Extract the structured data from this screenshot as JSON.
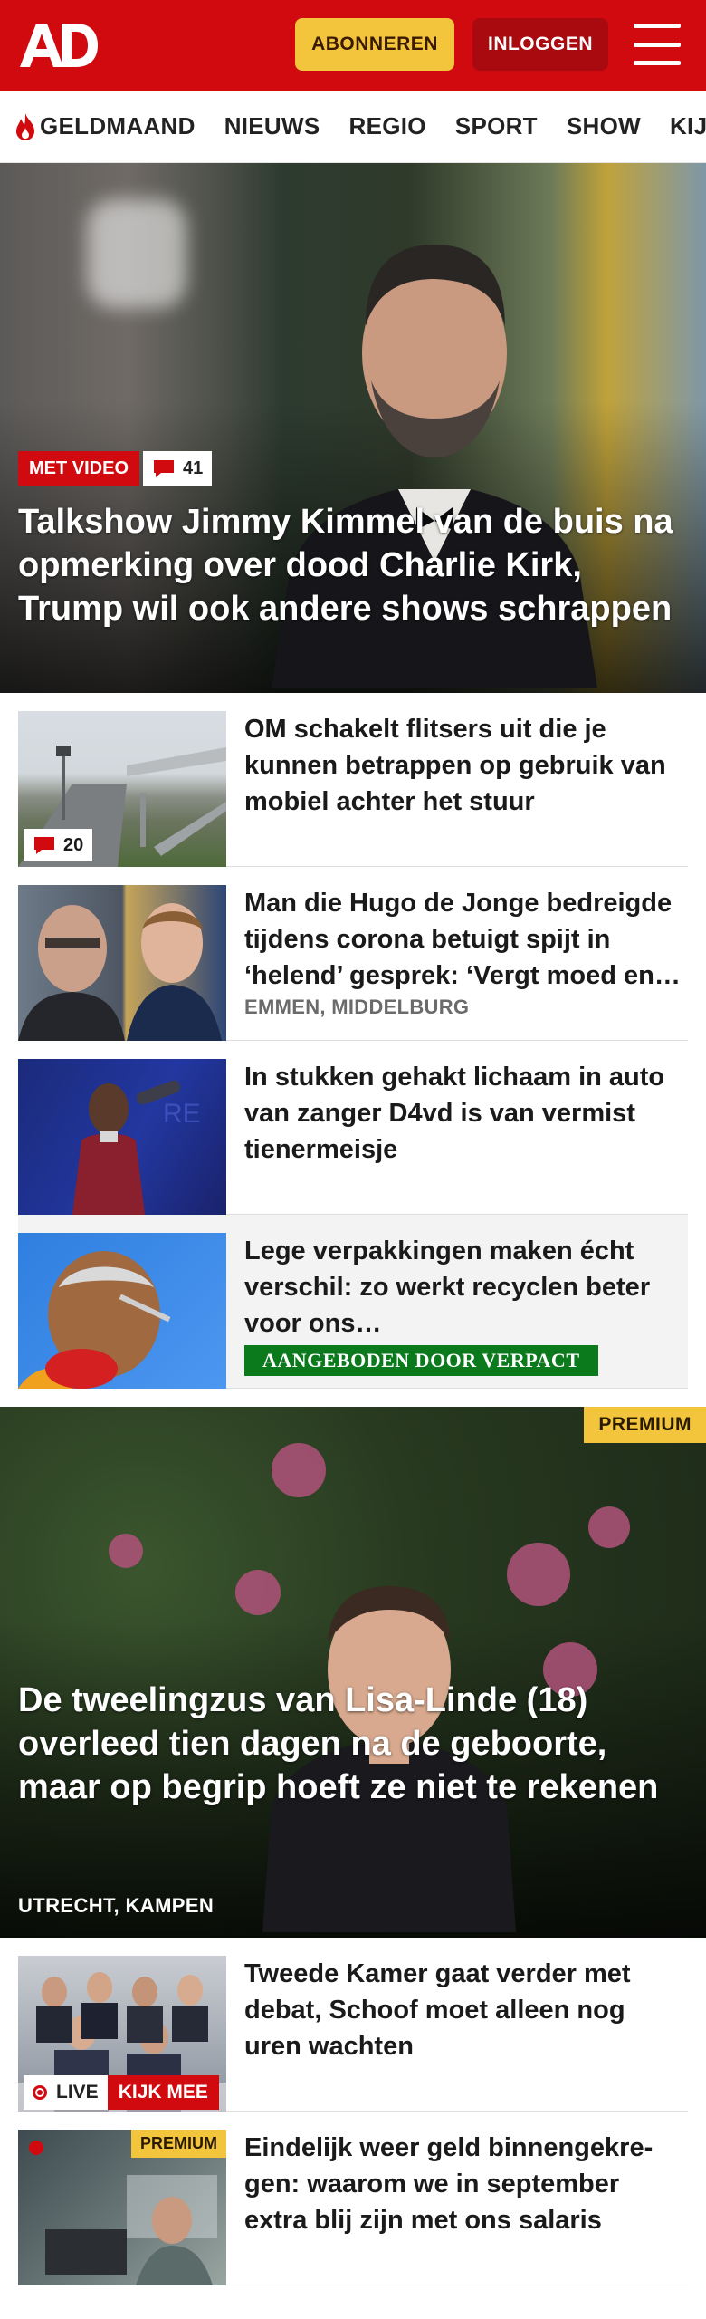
{
  "header": {
    "logo_text": "AD",
    "subscribe_label": "ABONNEREN",
    "login_label": "INLOGGEN"
  },
  "nav": {
    "items": [
      {
        "label": "GELDMAAND",
        "icon": "flame-icon"
      },
      {
        "label": "NIEUWS"
      },
      {
        "label": "REGIO"
      },
      {
        "label": "SPORT"
      },
      {
        "label": "SHOW"
      },
      {
        "label": "KIJK"
      }
    ]
  },
  "hero": {
    "video_badge": "MET VIDEO",
    "comment_count": "41",
    "title": "Talkshow Jimmy Kimmel van de buis na opmerking over dood Charlie Kirk, Trump wil ook andere shows schrappen"
  },
  "articles": [
    {
      "title": "OM schakelt flitsers uit die je kunnen betrappen op gebruik van mobiel achter het stuur",
      "comment_count": "20"
    },
    {
      "title": "Man die Hugo de Jonge bedreigde tijdens corona betuigt spijt in ‘helend’ gesprek: ‘Vergt moed en…",
      "location": "EMMEN, MIDDELBURG"
    },
    {
      "title": "In stukken gehakt lichaam in auto van zanger D4vd is van vermist tienermeisje"
    },
    {
      "title": "Lege verpakkingen maken écht verschil: zo werkt recyclen beter voor ons…",
      "sponsor_label": "AANGEBODEN DOOR VERPACT"
    }
  ],
  "feature": {
    "premium_label": "PREMIUM",
    "title": "De tweelingzus van Lisa-Linde (18) overleed tien dagen na de geboorte, maar op begrip hoeft ze niet te rekenen",
    "location": "UTRECHT, KAMPEN"
  },
  "articles2": [
    {
      "title": "Tweede Kamer gaat verder met debat, Schoof moet alleen nog uren wachten",
      "live_label": "LIVE",
      "watch_label": "KIJK MEE"
    },
    {
      "title": "Eindelijk weer geld binnengekre­gen: waarom we in september extra blij zijn met ons salaris",
      "premium_label": "PREMIUM"
    }
  ],
  "colors": {
    "brand_red": "#d10a10",
    "subscribe_yellow": "#f2c53d",
    "sponsor_green": "#0a7a1c"
  }
}
